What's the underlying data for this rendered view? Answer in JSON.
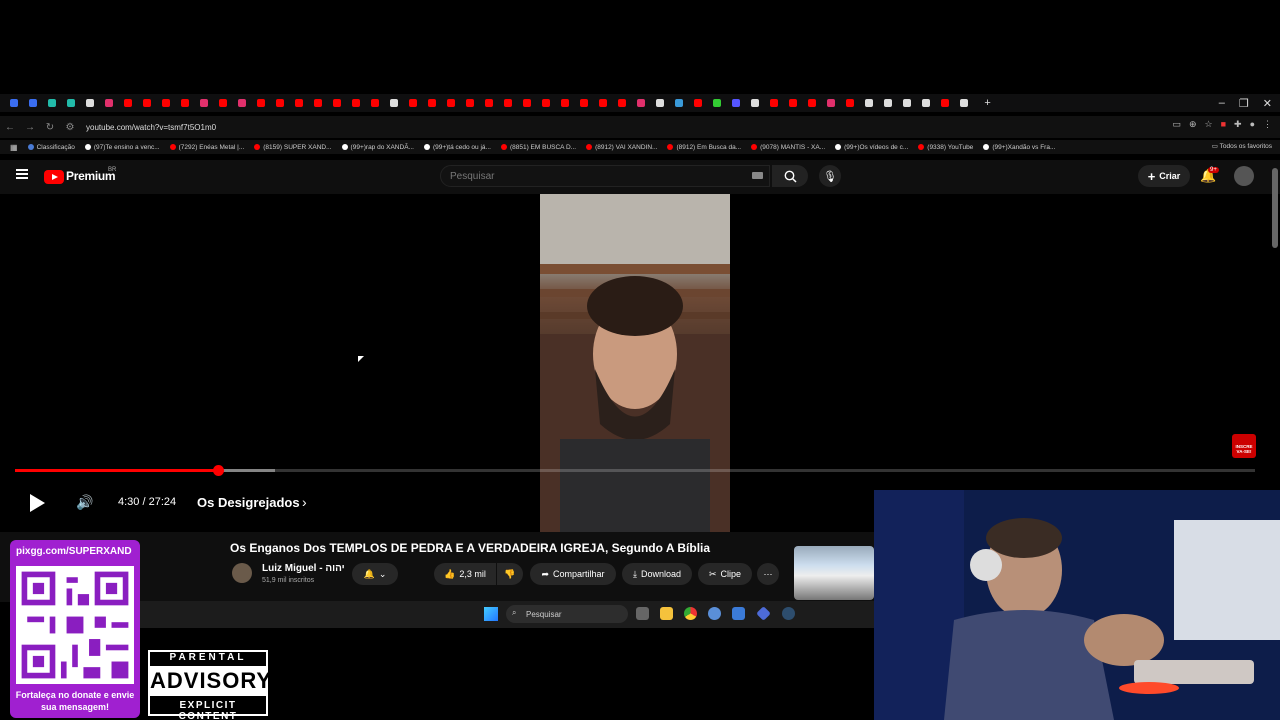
{
  "browser": {
    "url": "youtube.com/watch?v=tsmf7t5O1m0",
    "bookmarks": [
      {
        "label": "Classificação",
        "color": "#4a7bd4"
      },
      {
        "label": "(97)Te ensino a venc...",
        "color": "#ffffff"
      },
      {
        "label": "(7292) Enéas Metal |...",
        "color": "#ff0000"
      },
      {
        "label": "(8159) SUPER XAND...",
        "color": "#ff0000"
      },
      {
        "label": "(99+)rap do XANDÃ...",
        "color": "#ffffff"
      },
      {
        "label": "(99+)tá cedo ou já...",
        "color": "#ffffff"
      },
      {
        "label": "(8851) EM BUSCA D...",
        "color": "#ff0000"
      },
      {
        "label": "(8912) VAI XANDIN...",
        "color": "#ff0000"
      },
      {
        "label": "(8912) Em Busca da...",
        "color": "#ff0000"
      },
      {
        "label": "(9078) MANTIS - XA...",
        "color": "#ff0000"
      },
      {
        "label": "(99+)Os vídeos de c...",
        "color": "#ffffff"
      },
      {
        "label": "(9338) YouTube",
        "color": "#ff0000"
      },
      {
        "label": "(99+)Xandão vs Fra...",
        "color": "#ffffff"
      }
    ],
    "all_bookmarks": "Todos os favoritos"
  },
  "youtube": {
    "brand": "Premium",
    "region": "BR",
    "search_placeholder": "Pesquisar",
    "create_label": "Criar",
    "notif_badge": "9+"
  },
  "player": {
    "time": "4:30 / 27:24",
    "chapter": "Os Desigrejados",
    "progress_fraction": 0.164,
    "buffer_fraction": 0.21,
    "subscribe_badge": "INSCRE VA-SE!"
  },
  "video": {
    "title": "Os Enganos Dos TEMPLOS DE PEDRA E A VERDADEIRA IGREJA, Segundo A Bíblia",
    "channel": "Luiz Miguel - יהוה",
    "subscribers": "51,9 mil inscritos",
    "likes": "2,3 mil",
    "share": "Compartilhar",
    "download": "Download",
    "clip": "Clipe"
  },
  "taskbar": {
    "search_placeholder": "Pesquisar"
  },
  "overlay": {
    "pix_url": "pixgg.com/SUPERXAND",
    "donate_message": "Fortaleça no donate e envie sua mensagem!",
    "advisory_top": "PARENTAL",
    "advisory_main": "ADVISORY",
    "advisory_bottom": "EXPLICIT CONTENT"
  }
}
